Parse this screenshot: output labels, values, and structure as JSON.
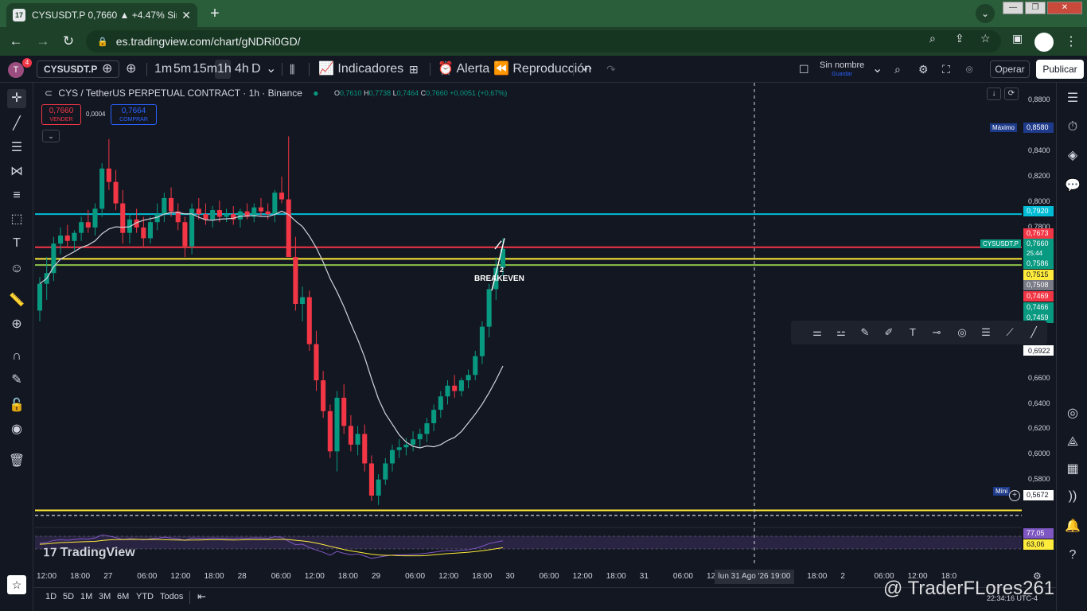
{
  "browser": {
    "tab_title": "CYSUSDT.P 0,7660 ▲ +4.47% Sin",
    "tab_favicon": "17",
    "url": "es.tradingview.com/chart/gNDRi0GD/",
    "colors": {
      "frame": "#2a5d3a",
      "toolbar": "#1d4229"
    }
  },
  "topbar": {
    "avatar_letter": "T",
    "notif_count": "4",
    "symbol": "CYSUSDT.P",
    "intervals": [
      "1m",
      "5m",
      "15m",
      "1h",
      "4h",
      "D"
    ],
    "active_interval": "1h",
    "indicators": "Indicadores",
    "alert": "Alerta",
    "replay": "Reproducción",
    "layout_name": "Sin nombre",
    "layout_save": "Guardar",
    "operar": "Operar",
    "publicar": "Publicar"
  },
  "legend": {
    "title": "CYS / TetherUS PERPETUAL CONTRACT · 1h · Binance",
    "o_key": "O",
    "o": "0,7610",
    "h_key": "H",
    "h": "0,7738",
    "l_key": "L",
    "l": "0,7464",
    "c_key": "C",
    "c": "0,7660",
    "change": "+0,0051 (+0,67%)",
    "sell_price": "0,7660",
    "sell_label": "VENDER",
    "spread": "0,0004",
    "buy_price": "0,7664",
    "buy_label": "COMPRAR"
  },
  "price_axis": {
    "ticks": [
      "0,8800",
      "0,8400",
      "0,8200",
      "0,8000",
      "0,7800",
      "0,6922",
      "0,6600",
      "0,6400",
      "0,6200",
      "0,6000",
      "0,5800"
    ],
    "max_label": "Máximo",
    "max_value": "0,8580",
    "min_label": "Míni",
    "min_value": "0,5672",
    "labels": [
      {
        "text": "0,7920",
        "color": "#00bcd4"
      },
      {
        "text": "0,7673",
        "color": "#f23645"
      },
      {
        "text": "0,7660",
        "color": "#089981"
      },
      {
        "text": "25:44",
        "color": "#089981"
      },
      {
        "text": "0,7586",
        "color": "#089981"
      },
      {
        "text": "0,7515",
        "color": "#ffeb3b"
      },
      {
        "text": "0,7508",
        "color": "#787b86"
      },
      {
        "text": "0,7469",
        "color": "#f23645"
      },
      {
        "text": "0,7466",
        "color": "#089981"
      },
      {
        "text": "0,7459",
        "color": "#089981"
      }
    ],
    "symbol_tag": "CYSUSDT.P",
    "osc_values": [
      "77,05",
      "63,06"
    ]
  },
  "time_axis": [
    "12:00",
    "18:00",
    "27",
    "06:00",
    "12:00",
    "18:00",
    "28",
    "06:00",
    "12:00",
    "18:00",
    "29",
    "06:00",
    "12:00",
    "18:00",
    "30",
    "06:00",
    "12:00",
    "18:00",
    "31",
    "06:00",
    "12",
    "06:00",
    "12:00",
    "18:00",
    "2",
    "06:00",
    "12:00",
    "18:0"
  ],
  "crosshair_time": "lun 31 Ago '26   19:00",
  "annotation": {
    "label": "BREAKEVEN",
    "num": "2"
  },
  "bottom": {
    "ranges": [
      "1D",
      "5D",
      "1M",
      "3M",
      "6M",
      "YTD",
      "Todos"
    ],
    "clock": "22:34:16 UTC-4"
  },
  "logo": "TradingView",
  "watermark": "@ TraderFLores261",
  "chart_data": {
    "type": "candlestick",
    "title": "CYS / TetherUS PERPETUAL CONTRACT · 1h · Binance",
    "ylim": [
      0.56,
      0.89
    ],
    "horizontal_lines": [
      {
        "value": 0.792,
        "color": "#00bcd4"
      },
      {
        "value": 0.7673,
        "color": "#f23645"
      },
      {
        "value": 0.7586,
        "color": "#ffeb3b"
      },
      {
        "value": 0.754,
        "color": "#8bc34a"
      },
      {
        "value": 0.571,
        "color": "#ffeb3b"
      },
      {
        "value": 0.5672,
        "color": "#ffffff"
      }
    ],
    "ma_color": "#d1d4dc",
    "candles": [
      [
        0.72,
        0.745,
        0.712,
        0.74
      ],
      [
        0.74,
        0.76,
        0.728,
        0.748
      ],
      [
        0.748,
        0.775,
        0.742,
        0.77
      ],
      [
        0.77,
        0.782,
        0.762,
        0.776
      ],
      [
        0.776,
        0.784,
        0.768,
        0.772
      ],
      [
        0.772,
        0.78,
        0.765,
        0.778
      ],
      [
        0.778,
        0.79,
        0.772,
        0.786
      ],
      [
        0.786,
        0.795,
        0.778,
        0.782
      ],
      [
        0.782,
        0.8,
        0.776,
        0.796
      ],
      [
        0.796,
        0.83,
        0.79,
        0.826
      ],
      [
        0.826,
        0.848,
        0.81,
        0.816
      ],
      [
        0.816,
        0.825,
        0.795,
        0.8
      ],
      [
        0.8,
        0.81,
        0.77,
        0.778
      ],
      [
        0.778,
        0.792,
        0.77,
        0.788
      ],
      [
        0.788,
        0.796,
        0.778,
        0.782
      ],
      [
        0.782,
        0.79,
        0.768,
        0.774
      ],
      [
        0.774,
        0.79,
        0.77,
        0.786
      ],
      [
        0.786,
        0.8,
        0.78,
        0.792
      ],
      [
        0.792,
        0.808,
        0.786,
        0.804
      ],
      [
        0.804,
        0.812,
        0.79,
        0.794
      ],
      [
        0.794,
        0.8,
        0.78,
        0.786
      ],
      [
        0.786,
        0.79,
        0.76,
        0.768
      ],
      [
        0.768,
        0.8,
        0.762,
        0.796
      ],
      [
        0.796,
        0.804,
        0.788,
        0.792
      ],
      [
        0.792,
        0.8,
        0.784,
        0.788
      ],
      [
        0.788,
        0.798,
        0.782,
        0.795
      ],
      [
        0.795,
        0.802,
        0.786,
        0.79
      ],
      [
        0.79,
        0.796,
        0.786,
        0.792
      ],
      [
        0.792,
        0.798,
        0.784,
        0.788
      ],
      [
        0.788,
        0.796,
        0.782,
        0.794
      ],
      [
        0.794,
        0.8,
        0.788,
        0.79
      ],
      [
        0.79,
        0.8,
        0.786,
        0.797
      ],
      [
        0.797,
        0.804,
        0.79,
        0.794
      ],
      [
        0.794,
        0.8,
        0.788,
        0.792
      ],
      [
        0.792,
        0.81,
        0.786,
        0.808
      ],
      [
        0.808,
        0.82,
        0.8,
        0.803
      ],
      [
        0.803,
        0.85,
        0.77,
        0.76
      ],
      [
        0.76,
        0.775,
        0.72,
        0.725
      ],
      [
        0.725,
        0.738,
        0.712,
        0.73
      ],
      [
        0.73,
        0.735,
        0.69,
        0.695
      ],
      [
        0.695,
        0.705,
        0.66,
        0.668
      ],
      [
        0.668,
        0.675,
        0.64,
        0.645
      ],
      [
        0.645,
        0.65,
        0.61,
        0.615
      ],
      [
        0.615,
        0.66,
        0.6,
        0.655
      ],
      [
        0.655,
        0.665,
        0.628,
        0.634
      ],
      [
        0.634,
        0.642,
        0.615,
        0.62
      ],
      [
        0.62,
        0.634,
        0.612,
        0.628
      ],
      [
        0.628,
        0.635,
        0.6,
        0.606
      ],
      [
        0.606,
        0.612,
        0.578,
        0.582
      ],
      [
        0.582,
        0.598,
        0.575,
        0.594
      ],
      [
        0.594,
        0.61,
        0.59,
        0.606
      ],
      [
        0.606,
        0.62,
        0.6,
        0.616
      ],
      [
        0.616,
        0.624,
        0.61,
        0.618
      ],
      [
        0.618,
        0.625,
        0.612,
        0.62
      ],
      [
        0.62,
        0.63,
        0.615,
        0.624
      ],
      [
        0.624,
        0.632,
        0.618,
        0.628
      ],
      [
        0.628,
        0.64,
        0.622,
        0.636
      ],
      [
        0.636,
        0.65,
        0.63,
        0.646
      ],
      [
        0.646,
        0.66,
        0.64,
        0.656
      ],
      [
        0.656,
        0.668,
        0.65,
        0.664
      ],
      [
        0.664,
        0.672,
        0.655,
        0.66
      ],
      [
        0.66,
        0.67,
        0.656,
        0.668
      ],
      [
        0.668,
        0.676,
        0.662,
        0.672
      ],
      [
        0.672,
        0.69,
        0.668,
        0.686
      ],
      [
        0.686,
        0.712,
        0.68,
        0.708
      ],
      [
        0.708,
        0.74,
        0.7,
        0.736
      ],
      [
        0.736,
        0.76,
        0.728,
        0.752
      ],
      [
        0.752,
        0.774,
        0.746,
        0.766
      ]
    ]
  }
}
